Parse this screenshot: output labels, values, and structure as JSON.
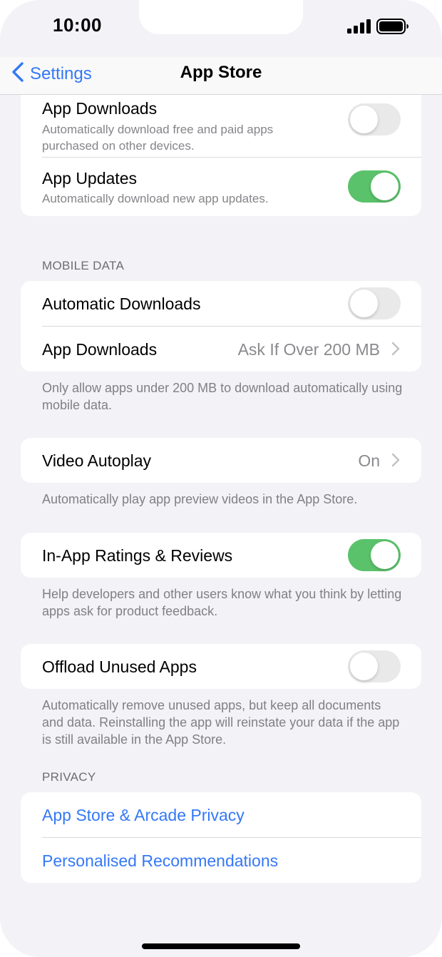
{
  "status_bar": {
    "time": "10:00"
  },
  "nav": {
    "back_label": "Settings",
    "title": "App Store"
  },
  "auto_downloads_group": {
    "app_downloads": {
      "title": "App Downloads",
      "subtitle": "Automatically download free and paid apps purchased on other devices.",
      "enabled": false
    },
    "app_updates": {
      "title": "App Updates",
      "subtitle": "Automatically download new app updates.",
      "enabled": true
    }
  },
  "mobile_data": {
    "header": "MOBILE DATA",
    "automatic_downloads": {
      "title": "Automatic Downloads",
      "enabled": false
    },
    "app_downloads": {
      "title": "App Downloads",
      "value": "Ask If Over 200 MB"
    },
    "footer": "Only allow apps under 200 MB to download automatically using mobile data."
  },
  "video_autoplay": {
    "title": "Video Autoplay",
    "value": "On",
    "footer": "Automatically play app preview videos in the App Store."
  },
  "ratings": {
    "title": "In-App Ratings & Reviews",
    "enabled": true,
    "footer": "Help developers and other users know what you think by letting apps ask for product feedback."
  },
  "offload": {
    "title": "Offload Unused Apps",
    "enabled": false,
    "footer": "Automatically remove unused apps, but keep all documents and data. Reinstalling the app will reinstate your data if the app is still available in the App Store."
  },
  "privacy": {
    "header": "PRIVACY",
    "links": [
      "App Store & Arcade Privacy",
      "Personalised Recommendations"
    ]
  },
  "colors": {
    "accent": "#3478f6",
    "toggle_on": "#5ac26a",
    "toggle_off": "#e9e9ea",
    "background": "#f2f2f7"
  }
}
